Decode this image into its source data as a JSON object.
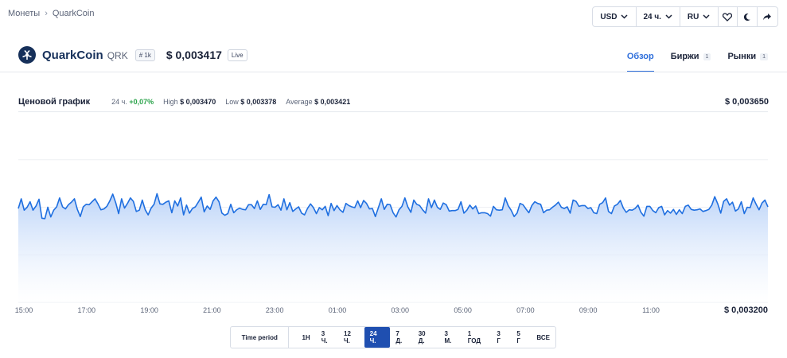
{
  "breadcrumb": {
    "root": "Монеты",
    "current": "QuarkCoin"
  },
  "topbar": {
    "currency": "USD",
    "period": "24 ч.",
    "language": "RU",
    "icons": [
      "heart-icon",
      "moon-icon",
      "share-icon"
    ]
  },
  "coin": {
    "name": "QuarkCoin",
    "symbol": "QRK",
    "rank": "# 1k",
    "price": "$ 0,003417",
    "live": "Live"
  },
  "tabs": [
    {
      "label": "Обзор",
      "count": ""
    },
    {
      "label": "Биржи",
      "count": "1"
    },
    {
      "label": "Рынки",
      "count": "1"
    }
  ],
  "stats": {
    "title": "Ценовой график",
    "change_label": "24 ч.",
    "change_value": "+0,07%",
    "high_label": "High",
    "high_value": "$ 0,003470",
    "low_label": "Low",
    "low_value": "$ 0,003378",
    "avg_label": "Average",
    "avg_value": "$ 0,003421"
  },
  "colors": {
    "accent": "#2f6fdb",
    "positive": "#2aa34a",
    "line": "#1f6fe0",
    "fill": "#cfe0fb",
    "text": "#1a2238"
  },
  "chart_data": {
    "type": "area",
    "title": "Ценовой график",
    "ylim": [
      0.0032,
      0.00365
    ],
    "y_max_label": "$ 0,003650",
    "y_min_label": "$ 0,003200",
    "xticks": [
      "15:00",
      "17:00",
      "19:00",
      "21:00",
      "23:00",
      "01:00",
      "03:00",
      "05:00",
      "07:00",
      "09:00",
      "11:00"
    ],
    "grid": true,
    "values": [
      0.003422,
      0.003445,
      0.003418,
      0.003425,
      0.003438,
      0.003418,
      0.003428,
      0.003444,
      0.003399,
      0.003398,
      0.003425,
      0.003402,
      0.003418,
      0.003426,
      0.003447,
      0.003426,
      0.003421,
      0.003431,
      0.003437,
      0.003445,
      0.00342,
      0.003403,
      0.003426,
      0.003432,
      0.003431,
      0.003438,
      0.003445,
      0.003433,
      0.003419,
      0.003421,
      0.003427,
      0.00344,
      0.003456,
      0.003436,
      0.00341,
      0.003445,
      0.003423,
      0.003434,
      0.003447,
      0.003439,
      0.003415,
      0.003418,
      0.003442,
      0.003419,
      0.003407,
      0.003423,
      0.003432,
      0.003457,
      0.003433,
      0.003432,
      0.003437,
      0.00344,
      0.003412,
      0.00344,
      0.003428,
      0.003447,
      0.003407,
      0.00343,
      0.003411,
      0.003422,
      0.003426,
      0.003437,
      0.003449,
      0.003414,
      0.003428,
      0.00342,
      0.00344,
      0.003449,
      0.003438,
      0.003411,
      0.003406,
      0.00341,
      0.003432,
      0.003412,
      0.003419,
      0.003423,
      0.00342,
      0.003419,
      0.003431,
      0.003431,
      0.003422,
      0.00344,
      0.00342,
      0.003432,
      0.003431,
      0.003455,
      0.003426,
      0.003425,
      0.003431,
      0.003418,
      0.003445,
      0.003419,
      0.003436,
      0.003415,
      0.003421,
      0.003426,
      0.003411,
      0.003407,
      0.003422,
      0.003433,
      0.003424,
      0.00341,
      0.003424,
      0.003419,
      0.003427,
      0.003405,
      0.003434,
      0.003417,
      0.003429,
      0.003419,
      0.003413,
      0.003434,
      0.003429,
      0.003426,
      0.003424,
      0.00344,
      0.003424,
      0.003441,
      0.003434,
      0.003421,
      0.003422,
      0.003403,
      0.003424,
      0.003445,
      0.00342,
      0.003432,
      0.003431,
      0.003412,
      0.003402,
      0.003419,
      0.003427,
      0.003447,
      0.003426,
      0.003413,
      0.003442,
      0.003432,
      0.003429,
      0.003419,
      0.003411,
      0.003445,
      0.003424,
      0.003442,
      0.003425,
      0.00342,
      0.003435,
      0.003431,
      0.003416,
      0.003417,
      0.003417,
      0.00342,
      0.003438,
      0.003411,
      0.003418,
      0.00343,
      0.003421,
      0.003428,
      0.00341,
      0.003412,
      0.003412,
      0.00341,
      0.003404,
      0.003427,
      0.003419,
      0.003418,
      0.003419,
      0.003447,
      0.003429,
      0.003418,
      0.003403,
      0.003411,
      0.003434,
      0.003431,
      0.003421,
      0.003412,
      0.003429,
      0.003438,
      0.003434,
      0.003432,
      0.003412,
      0.003418,
      0.003419,
      0.003425,
      0.00343,
      0.003437,
      0.003425,
      0.003422,
      0.003426,
      0.003411,
      0.003442,
      0.003439,
      0.003427,
      0.003429,
      0.003429,
      0.003422,
      0.003424,
      0.003412,
      0.00341,
      0.003432,
      0.003436,
      0.003447,
      0.003415,
      0.00341,
      0.003428,
      0.003432,
      0.003441,
      0.003423,
      0.003413,
      0.003419,
      0.003418,
      0.003422,
      0.00343,
      0.003413,
      0.003404,
      0.003427,
      0.003427,
      0.003417,
      0.003412,
      0.003424,
      0.003427,
      0.003407,
      0.003417,
      0.003411,
      0.00342,
      0.003408,
      0.003419,
      0.00341,
      0.003427,
      0.00343,
      0.00342,
      0.003418,
      0.003419,
      0.003421,
      0.003415,
      0.003417,
      0.00342,
      0.00343,
      0.00345,
      0.003433,
      0.003411,
      0.003439,
      0.003445,
      0.00343,
      0.003437,
      0.003416,
      0.003421,
      0.003438,
      0.00341,
      0.003425,
      0.003424,
      0.003447,
      0.003432,
      0.003419,
      0.003435,
      0.003442,
      0.003426
    ]
  },
  "periods": {
    "label": "Time period",
    "items": [
      "1Н",
      "3 Ч.",
      "12 Ч.",
      "24 Ч.",
      "7 Д.",
      "30 Д.",
      "3 М.",
      "1 ГОД",
      "3 Г",
      "5 Г",
      "ВСЕ"
    ],
    "active": "24 Ч."
  }
}
